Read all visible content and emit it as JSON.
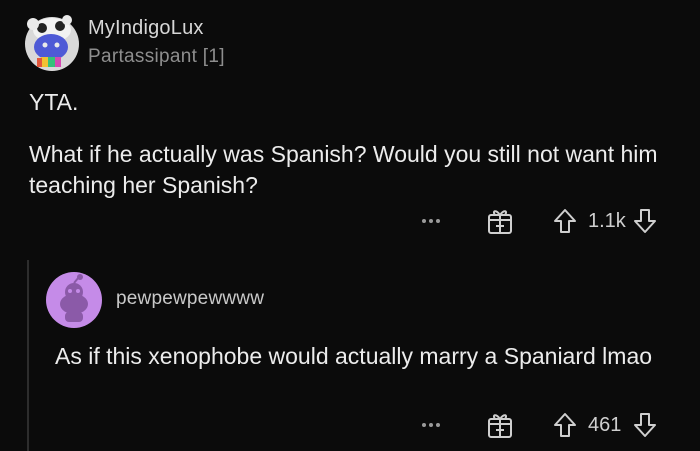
{
  "comment": {
    "username": "MyIndigoLux",
    "flair": "Partassipant [1]",
    "body": [
      "YTA.",
      "What if he actually was Spanish? Would you still not want him teaching her Spanish?"
    ],
    "score": "1.1k",
    "more_icon": "more-options-icon",
    "award_icon": "award-gift-icon",
    "upvote_icon": "upvote-arrow-icon",
    "downvote_icon": "downvote-arrow-icon"
  },
  "reply": {
    "username": "pewpewpewwww",
    "body": "As if this xenophobe would actually marry a Spaniard lmao",
    "score": "461"
  },
  "colors": {
    "background": "#0b0b0b",
    "text": "#ececec",
    "muted": "#8e8e8e",
    "reply_avatar": "#c58be8"
  }
}
